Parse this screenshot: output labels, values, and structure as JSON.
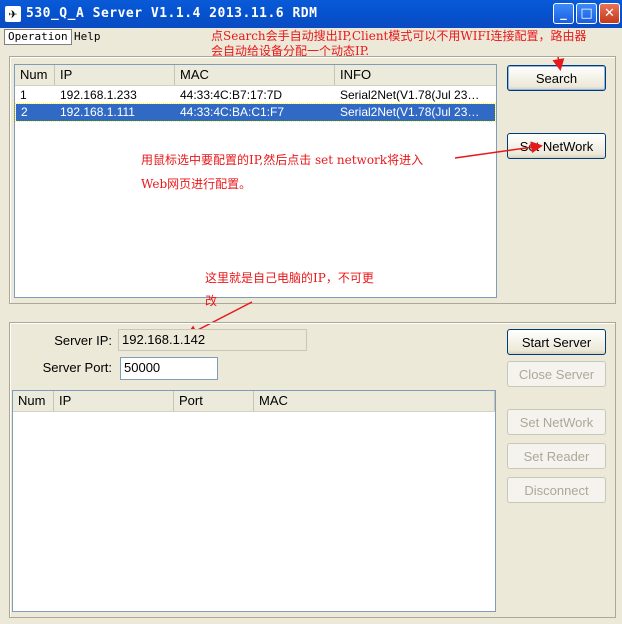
{
  "window": {
    "title": "530_Q_A Server V1.1.4 2013.11.6 RDM",
    "icon_glyph": "✈",
    "minimize_glyph": "_",
    "maximize_glyph": "□",
    "close_glyph": "✕"
  },
  "menu": {
    "operation": "Operation",
    "help": "Help"
  },
  "annotations": {
    "search_line1": "点Search会手自动搜出IP,Client模式可以不用WIFI连接配置，路由器",
    "search_line2": "会自动给设备分配一个动态IP.",
    "setnet_line1": "用鼠标选中要配置的IP,然后点击 set network将进入",
    "setnet_line2": "Web网页进行配置。",
    "serverip_line1": "这里就是自己电脑的IP，不可更",
    "serverip_line2": "改",
    "color": "#e8181a"
  },
  "devices_table": {
    "columns": [
      "Num",
      "IP",
      "MAC",
      "INFO"
    ],
    "rows": [
      {
        "num": "1",
        "ip": "192.168.1.233",
        "mac": "44:33:4C:B7:17:7D",
        "info": "Serial2Net(V1.78(Jul 23…",
        "selected": false
      },
      {
        "num": "2",
        "ip": "192.168.1.111",
        "mac": "44:33:4C:BA:C1:F7",
        "info": "Serial2Net(V1.78(Jul 23…",
        "selected": true
      }
    ]
  },
  "buttons": {
    "search": "Search",
    "set_network_top": "Set NetWork",
    "start_server": "Start Server",
    "close_server": "Close Server",
    "set_network_bottom": "Set NetWork",
    "set_reader": "Set Reader",
    "disconnect": "Disconnect"
  },
  "server": {
    "ip_label": "Server IP:",
    "ip_value": "192.168.1.142",
    "port_label": "Server Port:",
    "port_value": "50000"
  },
  "clients_table": {
    "columns": [
      "Num",
      "IP",
      "Port",
      "MAC"
    ],
    "rows": []
  }
}
